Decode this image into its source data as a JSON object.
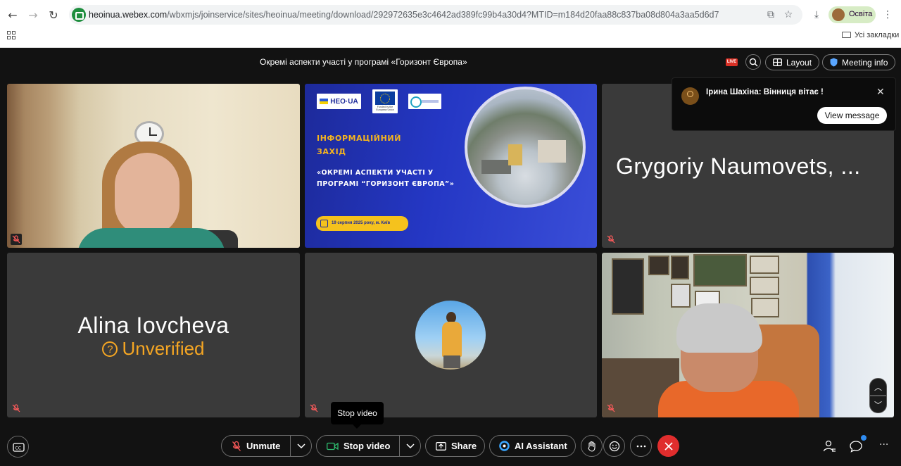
{
  "browser": {
    "url_host": "heoinua.webex.com",
    "url_path": "/wbxmjs/joinservice/sites/heoinua/meeting/download/292972635e3c4642ad389fc99b4a30d4?MTID=m184d20faa88c837ba08d804a3aa5d6d7",
    "profile_label": "Освіта",
    "bookmarks_label": "Усі закладки"
  },
  "meeting": {
    "title": "Окремі аспекти участі у програмі «Горизонт Європа»",
    "live_badge": "LIVE",
    "layout_label": "Layout",
    "meeting_info_label": "Meeting info"
  },
  "notification": {
    "message": "Ірина Шахіна: Вінниця вітає !",
    "view_button": "View message"
  },
  "slide": {
    "logo_text": "HEO·UA",
    "eu_caption": "Funded by the European Union",
    "event_line1": "ІНФОРМАЦІЙНИЙ",
    "event_line2": "ЗАХІД",
    "headline1": "«ОКРЕМІ АСПЕКТИ УЧАСТІ У",
    "headline2": "ПРОГРАМІ “ГОРИЗОНТ ЄВРОПА”»",
    "date": "19 серпня 2025 року, м. Київ"
  },
  "participants": [
    {
      "name": "Grygoriy Naumovets, ..."
    },
    {
      "name": "Alina Iovcheva",
      "status": "Unverified"
    }
  ],
  "tooltip": "Stop video",
  "controls": {
    "unmute": "Unmute",
    "stop_video": "Stop video",
    "share": "Share",
    "ai_assistant": "AI Assistant"
  },
  "colors": {
    "accent_unverified": "#f5a623",
    "leave": "#e02d2d",
    "live": "#d93025"
  }
}
